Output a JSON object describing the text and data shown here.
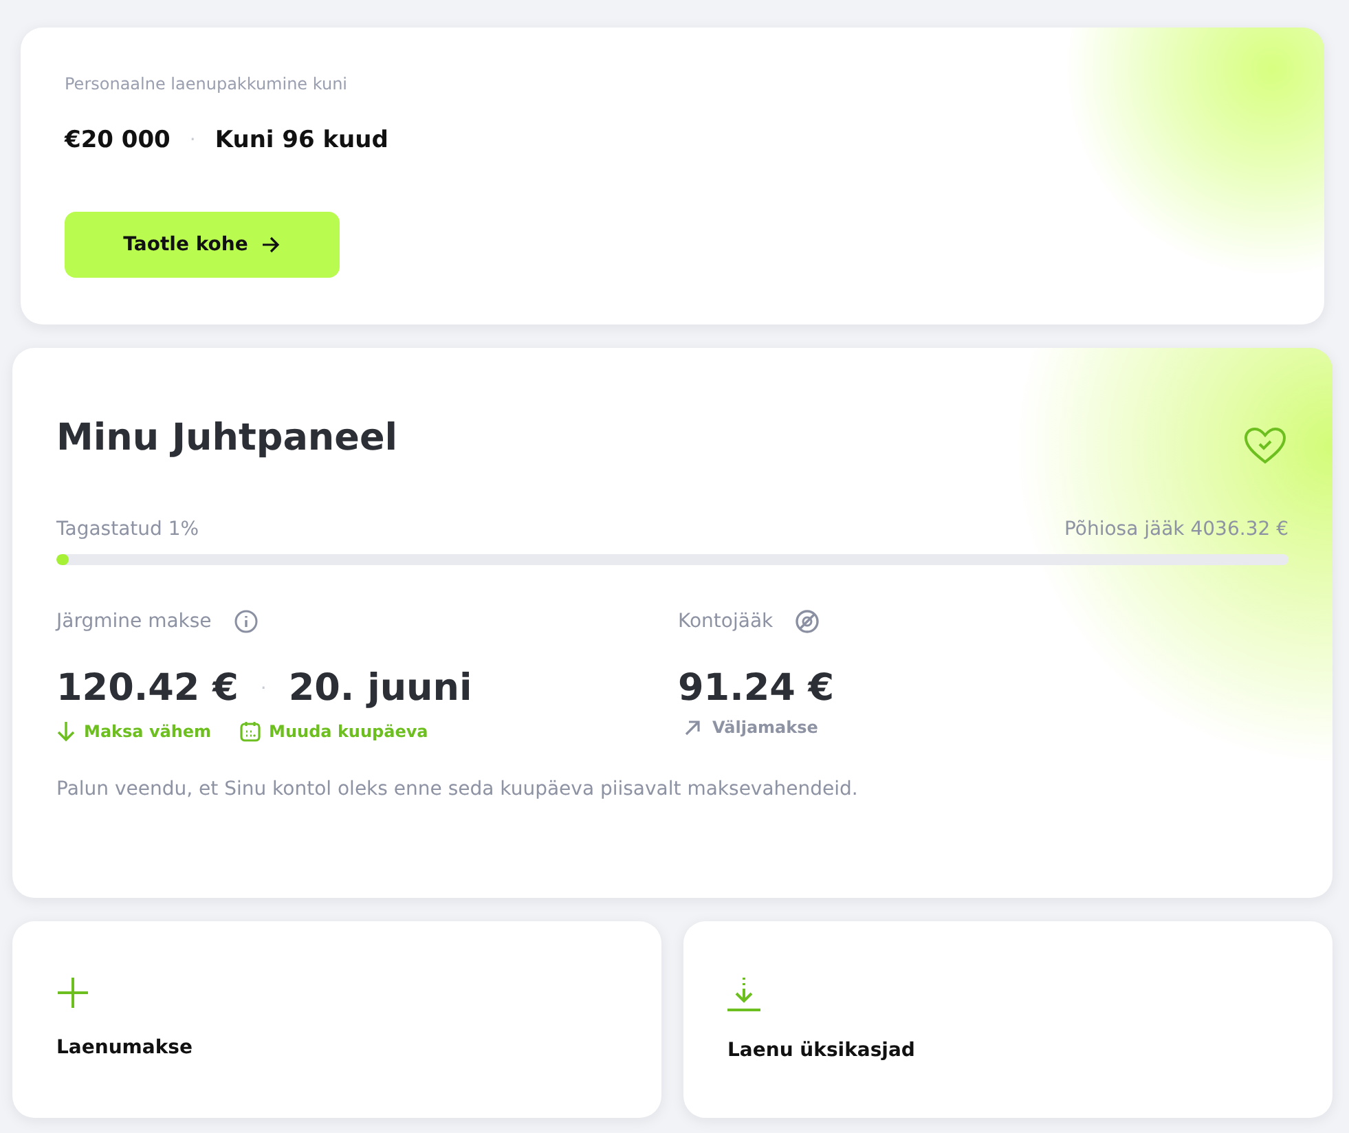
{
  "offer": {
    "caption": "Personaalne laenupakkumine kuni",
    "amount": "€20 000",
    "separator": "·",
    "term": "Kuni 96 kuud",
    "button": "Taotle kohe"
  },
  "dashboard": {
    "title": "Minu Juhtpaneel",
    "progress": {
      "label": "Tagastatud 1%",
      "remaining": "Põhiosa jääk 4036.32 €",
      "level": 0.01
    },
    "next_payment": {
      "label": "Järgmine makse",
      "amount": "120.42 €",
      "separator": "·",
      "date": "20. juuni",
      "actions": [
        {
          "kind": "pay-less",
          "label": "Maksa vähem"
        },
        {
          "kind": "change-date",
          "label": "Muuda kuupäeva"
        }
      ]
    },
    "balance": {
      "label": "Kontojääk",
      "amount": "91.24 €",
      "action": "Väljamakse"
    },
    "note": "Palun veendu, et Sinu kontol oleks enne seda kuupäeva piisavalt maksevahendeid."
  },
  "tiles": [
    {
      "kind": "add",
      "label": "Laenumakse"
    },
    {
      "kind": "download",
      "label": "Laenu üksikasjad"
    }
  ]
}
